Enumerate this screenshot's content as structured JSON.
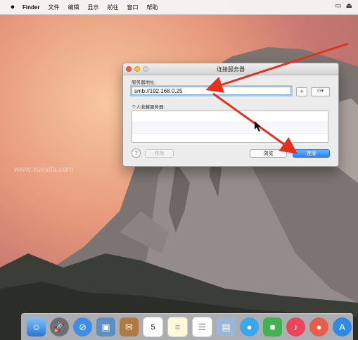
{
  "menubar": {
    "apple_icon": "",
    "items": [
      "Finder",
      "文件",
      "编辑",
      "显示",
      "前往",
      "窗口",
      "帮助"
    ],
    "right_icons": [
      "airplay-icon",
      "eject-icon"
    ]
  },
  "dialog": {
    "title": "连接服务器",
    "server_address_label": "服务器地址:",
    "server_address_value": "smb://192.168.0.25",
    "add_button": "+",
    "recent_button": "⊙▾",
    "favorites_label": "个人收藏服务器:",
    "help_button": "?",
    "remove_button": "移除",
    "browse_button": "浏览",
    "connect_button": "连接"
  },
  "watermark": "www.xuexila.com",
  "dock": {
    "apps": [
      "finder-icon",
      "launchpad-icon",
      "safari-icon",
      "preview-icon",
      "contacts-icon",
      "calendar-icon",
      "notes-icon",
      "reminders-icon",
      "photos-icon",
      "messages-icon",
      "facetime-icon",
      "music-icon",
      "photo-booth-icon",
      "app-store-icon"
    ],
    "calendar_day": "5"
  },
  "colors": {
    "annotation_arrow": "#e0321f",
    "connect_button": "#2f7ff1"
  }
}
